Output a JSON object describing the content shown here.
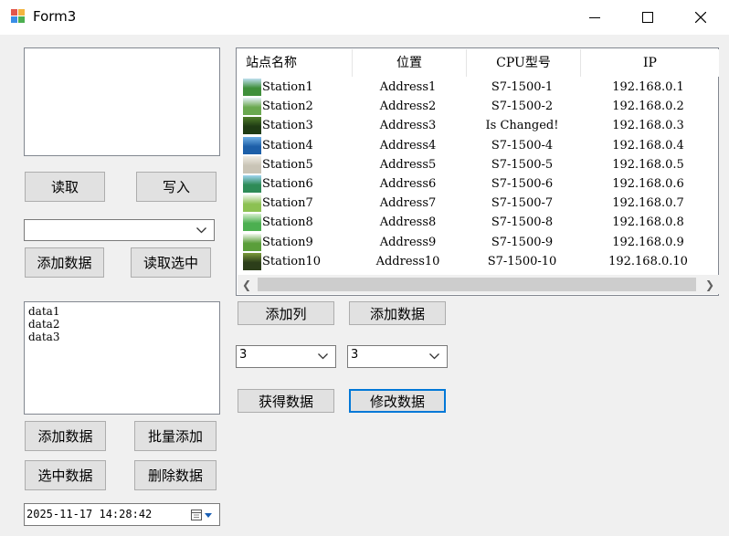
{
  "window": {
    "title": "Form3"
  },
  "left": {
    "read_button": "读取",
    "write_button": "写入",
    "combo_value": "",
    "add_data_button": "添加数据",
    "read_selected_button": "读取选中",
    "listbox_items": [
      "data1",
      "data2",
      "data3"
    ],
    "listbox_add_data_button": "添加数据",
    "batch_add_button": "批量添加",
    "select_data_button": "选中数据",
    "delete_data_button": "删除数据",
    "datetime_value": "2025-11-17 14:28:42"
  },
  "listview": {
    "columns": [
      "站点名称",
      "位置",
      "CPU型号",
      "IP"
    ],
    "rows": [
      {
        "name": "Station1",
        "location": "Address1",
        "cpu": "S7-1500-1",
        "ip": "192.168.0.1",
        "thumb": [
          "#3f8f3a",
          "#bfe0f0"
        ]
      },
      {
        "name": "Station2",
        "location": "Address2",
        "cpu": "S7-1500-2",
        "ip": "192.168.0.2",
        "thumb": [
          "#6aa84f",
          "#e6f2f8"
        ]
      },
      {
        "name": "Station3",
        "location": "Address3",
        "cpu": "Is  Changed!",
        "ip": "192.168.0.3",
        "thumb": [
          "#1f3b14",
          "#4f7d2a"
        ]
      },
      {
        "name": "Station4",
        "location": "Address4",
        "cpu": "S7-1500-4",
        "ip": "192.168.0.4",
        "thumb": [
          "#1d5fa8",
          "#6fb0e6"
        ]
      },
      {
        "name": "Station5",
        "location": "Address5",
        "cpu": "S7-1500-5",
        "ip": "192.168.0.5",
        "thumb": [
          "#c9c4b6",
          "#efece4"
        ]
      },
      {
        "name": "Station6",
        "location": "Address6",
        "cpu": "S7-1500-6",
        "ip": "192.168.0.6",
        "thumb": [
          "#2e8b57",
          "#9fd4f0"
        ]
      },
      {
        "name": "Station7",
        "location": "Address7",
        "cpu": "S7-1500-7",
        "ip": "192.168.0.7",
        "thumb": [
          "#8cc152",
          "#f4f9f2"
        ]
      },
      {
        "name": "Station8",
        "location": "Address8",
        "cpu": "S7-1500-8",
        "ip": "192.168.0.8",
        "thumb": [
          "#4caf50",
          "#d8f0d0"
        ]
      },
      {
        "name": "Station9",
        "location": "Address9",
        "cpu": "S7-1500-9",
        "ip": "192.168.0.9",
        "thumb": [
          "#5a9e3a",
          "#f2f8ee"
        ]
      },
      {
        "name": "Station10",
        "location": "Address10",
        "cpu": "S7-1500-10",
        "ip": "192.168.0.10",
        "thumb": [
          "#2c3e1a",
          "#7a9a3a"
        ]
      }
    ]
  },
  "right": {
    "add_column_button": "添加列",
    "add_data_button": "添加数据",
    "combo1_value": "3",
    "combo2_value": "3",
    "get_data_button": "获得数据",
    "modify_data_button": "修改数据"
  }
}
